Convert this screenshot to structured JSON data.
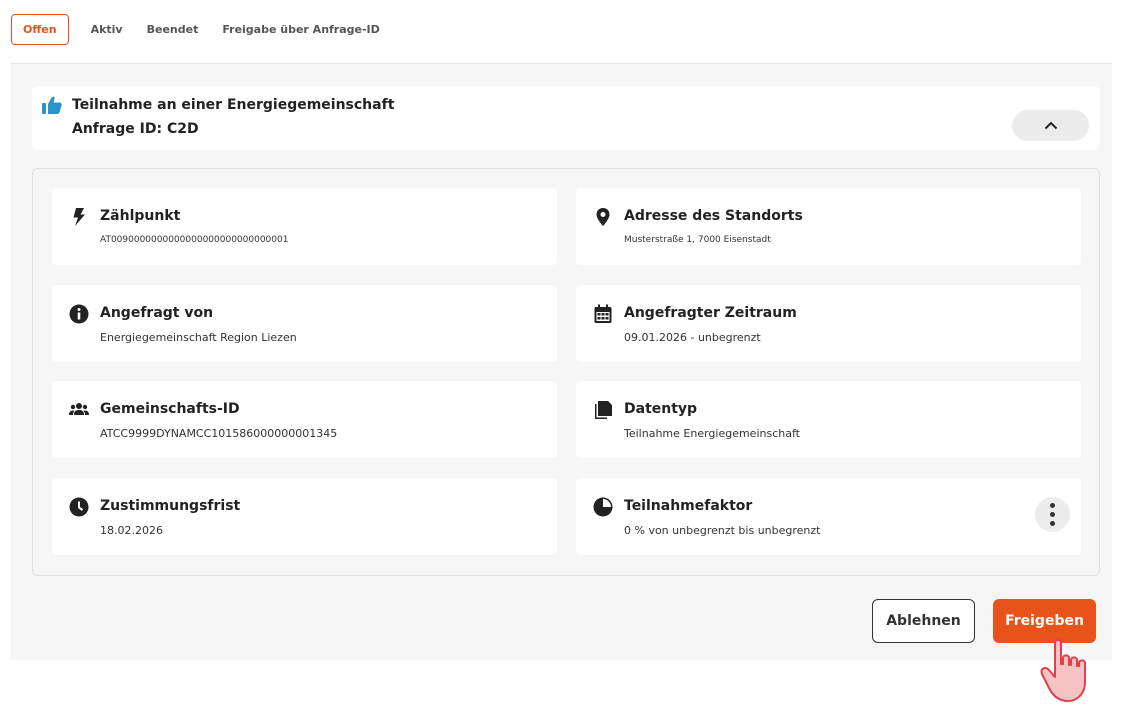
{
  "tabs": [
    {
      "label": "Offen",
      "active": true
    },
    {
      "label": "Aktiv",
      "active": false
    },
    {
      "label": "Beendet",
      "active": false
    },
    {
      "label": "Freigabe über Anfrage-ID",
      "active": false
    }
  ],
  "request": {
    "title": "Teilnahme an einer Energiegemeinschaft",
    "id_line": "Anfrage ID: C2D",
    "icon": "thumbs-up-icon"
  },
  "details": {
    "zaehlpunkt": {
      "label": "Zählpunkt",
      "value": "AT0090000000000000000000000000001",
      "icon": "lightning-icon"
    },
    "adresse": {
      "label": "Adresse des Standorts",
      "value": "Musterstraße 1, 7000 Eisenstadt",
      "icon": "location-pin-icon"
    },
    "angefragt_von": {
      "label": "Angefragt von",
      "value": "Energiegemeinschaft Region Liezen",
      "icon": "info-icon"
    },
    "zeitraum": {
      "label": "Angefragter Zeitraum",
      "value": "09.01.2026 - unbegrenzt",
      "icon": "calendar-icon"
    },
    "gemeinschafts_id": {
      "label": "Gemeinschafts-ID",
      "value": "ATCC9999DYNAMCC101586000000001345",
      "icon": "people-icon"
    },
    "datentyp": {
      "label": "Datentyp",
      "value": "Teilnahme Energiegemeinschaft",
      "icon": "documents-icon"
    },
    "frist": {
      "label": "Zustimmungsfrist",
      "value": "18.02.2026",
      "icon": "clock-icon"
    },
    "faktor": {
      "label": "Teilnahmefaktor",
      "value": "0 % von unbegrenzt bis unbegrenzt",
      "icon": "pie-chart-icon"
    }
  },
  "actions": {
    "reject_label": "Ablehnen",
    "approve_label": "Freigeben"
  },
  "colors": {
    "accent": "#e8521b",
    "icon_blue": "#2a93c9"
  }
}
